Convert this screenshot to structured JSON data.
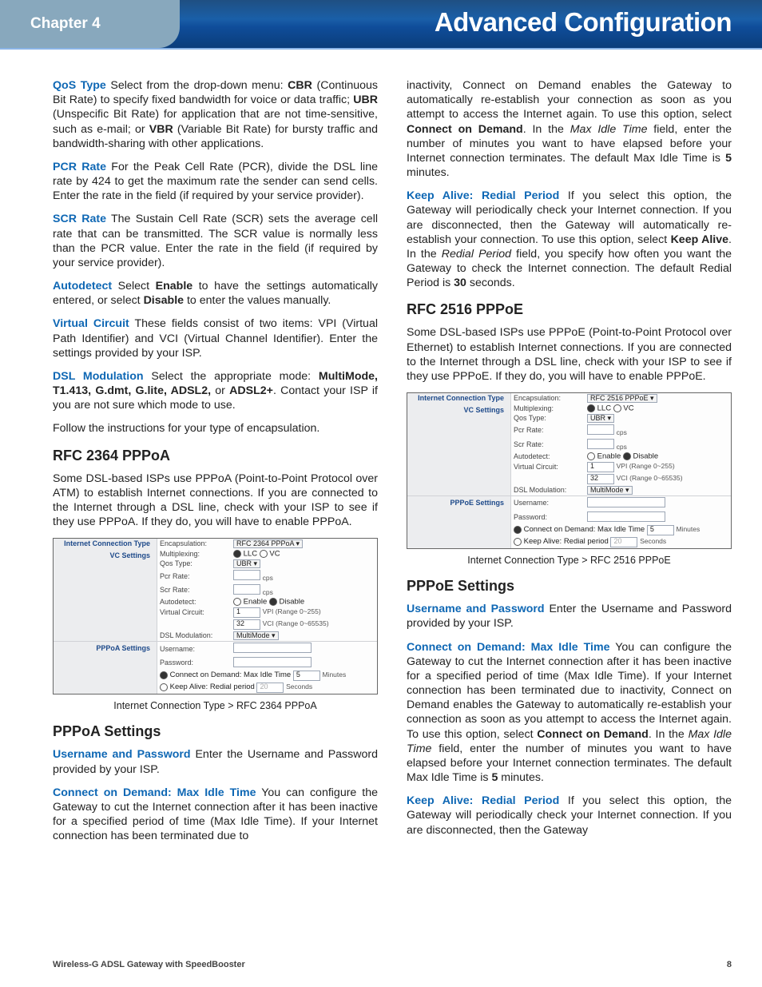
{
  "header": {
    "chapter": "Chapter 4",
    "title": "Advanced Configuration"
  },
  "footer": {
    "product": "Wireless-G ADSL Gateway with SpeedBooster",
    "page": "8"
  },
  "p": {
    "qos": "Select from the drop-down menu: ",
    "qos_cbr": "CBR",
    "qos_after_cbr": " (Continuous Bit Rate) to specify fixed bandwidth for voice or data traffic; ",
    "qos_ubr": "UBR",
    "qos_after_ubr": " (Unspecific Bit Rate) for application that are not time-sensitive, such as e-mail; or ",
    "qos_vbr": "VBR",
    "qos_after_vbr": " (Variable Bit Rate) for bursty traffic and bandwidth-sharing with other applications.",
    "pcr": "For the Peak Cell Rate (PCR), divide the DSL line rate by 424 to get the maximum rate the sender can send cells. Enter the rate in the field (if required by your service provider).",
    "scr": "The Sustain Cell Rate (SCR) sets the average cell rate that can be transmitted. The SCR value is normally less than the PCR value. Enter the rate in the field (if required by your service provider).",
    "auto_1": "Select ",
    "auto_en": "Enable",
    "auto_2": " to have the settings automatically entered, or select ",
    "auto_dis": "Disable",
    "auto_3": " to enter the values manually.",
    "vcirc": "These fields consist of two items: VPI (Virtual Path Identifier) and VCI (Virtual Channel Identifier). Enter the settings provided by your ISP.",
    "dslmod_1": "Select the appropriate mode: ",
    "dslmod_modes": "MultiMode, T1.413, G.dmt, G.lite, ADSL2, ",
    "dslmod_or": "or ",
    "dslmod_last": "ADSL2+",
    "dslmod_2": ". Contact your ISP if you are not sure which mode to use.",
    "follow": "Follow the instructions for your type of encapsulation.",
    "h_pppoa": "RFC 2364 PPPoA",
    "pppoa_intro": "Some DSL-based ISPs use PPPoA (Point-to-Point Protocol over ATM) to establish Internet connections. If you are connected to the Internet through a DSL line, check with your ISP to see if they use PPPoA. If they do, you will have to enable PPPoA.",
    "figcap_pppoa": "Internet Connection Type > RFC 2364 PPPoA",
    "h_pppoa_set": "PPPoA Settings",
    "userpass": "Enter the Username and Password provided by your ISP.",
    "cod_trunc": "You can configure the Gateway to cut the Internet connection after it has been inactive for a specified period of time (Max Idle Time). If your Internet connection has been terminated due to",
    "cod_1": "inactivity, Connect on Demand enables the Gateway to automatically re-establish your connection as soon as you attempt to access the Internet again. To use this option, select ",
    "cod_b": "Connect on Demand",
    "cod_2": ". In the ",
    "cod_i": "Max Idle Time",
    "cod_3": " field, enter the number of minutes you want to have elapsed before your Internet connection terminates. The default Max Idle Time is ",
    "cod_5": "5",
    "cod_4": " minutes.",
    "ka_1": "If you select this option, the Gateway will periodically check your Internet connection. If you are disconnected, then the Gateway will automatically re-establish your connection. To use this option, select ",
    "ka_b": "Keep Alive",
    "ka_2": ". In the ",
    "ka_i": "Redial Period",
    "ka_3": " field, you specify how often you want the Gateway to check the Internet connection. The default Redial Period is ",
    "ka_30": "30",
    "ka_4": " seconds.",
    "h_pppoe": "RFC 2516 PPPoE",
    "pppoe_intro": "Some DSL-based ISPs use PPPoE (Point-to-Point Protocol over Ethernet) to establish Internet connections. If you are connected to the Internet through a DSL line, check with your ISP to see if they use PPPoE. If they do, you will have to enable PPPoE.",
    "figcap_pppoe": "Internet Connection Type > RFC 2516 PPPoE",
    "h_pppoe_set": "PPPoE Settings",
    "cod_full": "You can configure the Gateway to cut the Internet connection after it has been inactive for a specified period of time (Max Idle Time). If your Internet connection has been terminated due to inactivity, Connect on Demand enables the Gateway to automatically re-establish your connection as soon as you attempt to access the Internet again. To use this option, select ",
    "ka_trunc": "If you select this option, the Gateway will periodically check your Internet connection. If you are disconnected, then the Gateway"
  },
  "terms": {
    "qos": "QoS Type",
    "pcr": "PCR Rate",
    "scr": "SCR Rate",
    "auto": "Autodetect",
    "vcirc": "Virtual Circuit",
    "dslmod": "DSL Modulation",
    "userpass": "Username and Password",
    "cod": "Connect on Demand: Max Idle Time",
    "ka": "Keep Alive: Redial Period"
  },
  "shot": {
    "row_ict": "Internet Connection Type",
    "row_vc": "VC Settings",
    "row_pppoa": "PPPoA Settings",
    "row_pppoe": "PPPoE Settings",
    "enc": "Encapsulation:",
    "enc_pppoa": "RFC 2364 PPPoA",
    "enc_pppoe": "RFC 2516 PPPoE",
    "mux": "Multiplexing:",
    "mux_llc": "LLC",
    "mux_vc": "VC",
    "qos": "Qos Type:",
    "qos_val": "UBR",
    "pcr": "Pcr Rate:",
    "cps": "cps",
    "scr": "Scr Rate:",
    "auto": "Autodetect:",
    "en": "Enable",
    "dis": "Disable",
    "vc": "Virtual Circuit:",
    "vpi_hint": "VPI (Range 0~255)",
    "vpi_val": "1",
    "vci_hint": "VCI (Range 0~65535)",
    "vci_val": "32",
    "dslm": "DSL Modulation:",
    "dslm_val": "MultiMode",
    "user": "Username:",
    "pass": "Password:",
    "cod": "Connect on Demand: Max Idle Time",
    "cod_val": "5",
    "min": "Minutes",
    "ka": "Keep Alive: Redial period",
    "ka_val": "20",
    "sec": "Seconds"
  }
}
